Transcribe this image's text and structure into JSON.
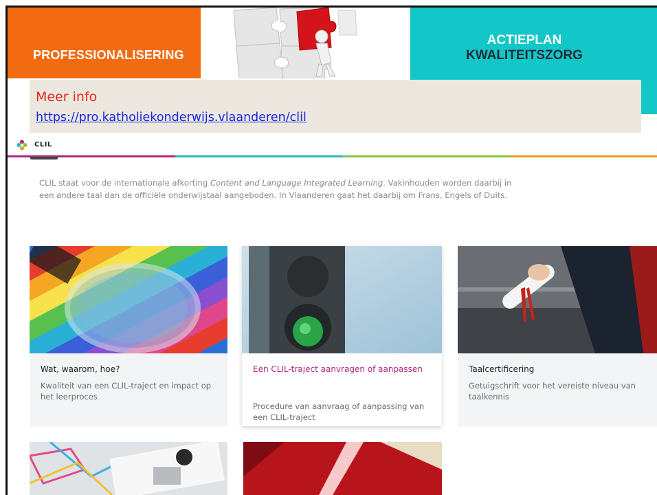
{
  "slide": {
    "left_banner": {
      "title": "PROFESSIONALISERING",
      "color": "#f26b10"
    },
    "right_banner": {
      "line1": "ACTIEPLAN",
      "line2": "KWALITEITSZORG",
      "color": "#13c6c7"
    },
    "info": {
      "label": "Meer info",
      "url": "https://pro.katholiekonderwijs.vlaanderen/clil"
    }
  },
  "page": {
    "section_name": "CLIL",
    "intro_part1": "CLIL staat voor de internationale afkorting ",
    "intro_em": "Content and Language Integrated Learning",
    "intro_part2": ". Vakinhouden worden daarbij in een andere taal dan de officiële onderwijstaal aangeboden. In Vlaanderen gaat het daarbij om Frans, Engels of Duits.",
    "cards": [
      {
        "title": "Wat, waarom, hoe?",
        "desc": "Kwaliteit van een CLIL-traject en impact op het leerproces",
        "image": "magnifying-glass-photo"
      },
      {
        "title": "Een CLIL-traject aanvragen of aanpassen",
        "desc": "Procedure van aanvraag of aanpassing van een CLIL-traject",
        "image": "traffic-light-photo"
      },
      {
        "title": "Taalcertificering",
        "desc": "Getuigschrift voor het vereiste niveau van taalkennis",
        "image": "diploma-photo"
      },
      {
        "title": "",
        "desc": "",
        "image": "office-people-photo"
      },
      {
        "title": "",
        "desc": "",
        "image": "red-book-photo"
      }
    ],
    "accent_colors": [
      "#b0267d",
      "#26b8c4",
      "#8cc63f",
      "#f29b1f"
    ]
  }
}
